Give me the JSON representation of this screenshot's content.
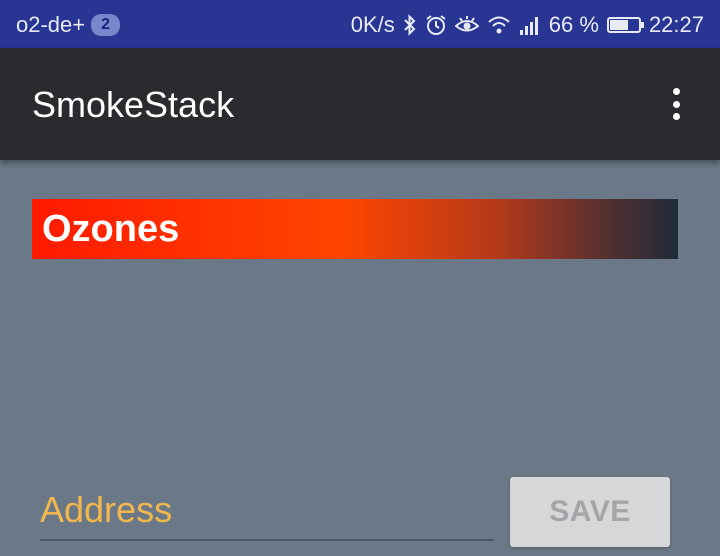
{
  "status_bar": {
    "carrier": "o2-de+",
    "notification_count": "2",
    "net_speed": "0K/s",
    "battery_percent": "66 %",
    "battery_level": 0.66,
    "time": "22:27",
    "icons": [
      "bluetooth-icon",
      "alarm-icon",
      "eye-icon",
      "wifi-icon",
      "cellular-signal-icon",
      "battery-icon"
    ]
  },
  "app_bar": {
    "title": "SmokeStack",
    "overflow_icon": "more-vert-icon"
  },
  "banner": {
    "label": "Ozones",
    "gradient_colors": [
      "#ff1a00",
      "#ff4500",
      "#1f2b3a"
    ]
  },
  "form": {
    "address_placeholder": "Address",
    "address_value": "",
    "save_label": "SAVE"
  },
  "colors": {
    "background": "#6b7887",
    "status_bar": "#283593",
    "app_bar": "#2b2a2e",
    "accent_hint": "#f2b84b"
  }
}
